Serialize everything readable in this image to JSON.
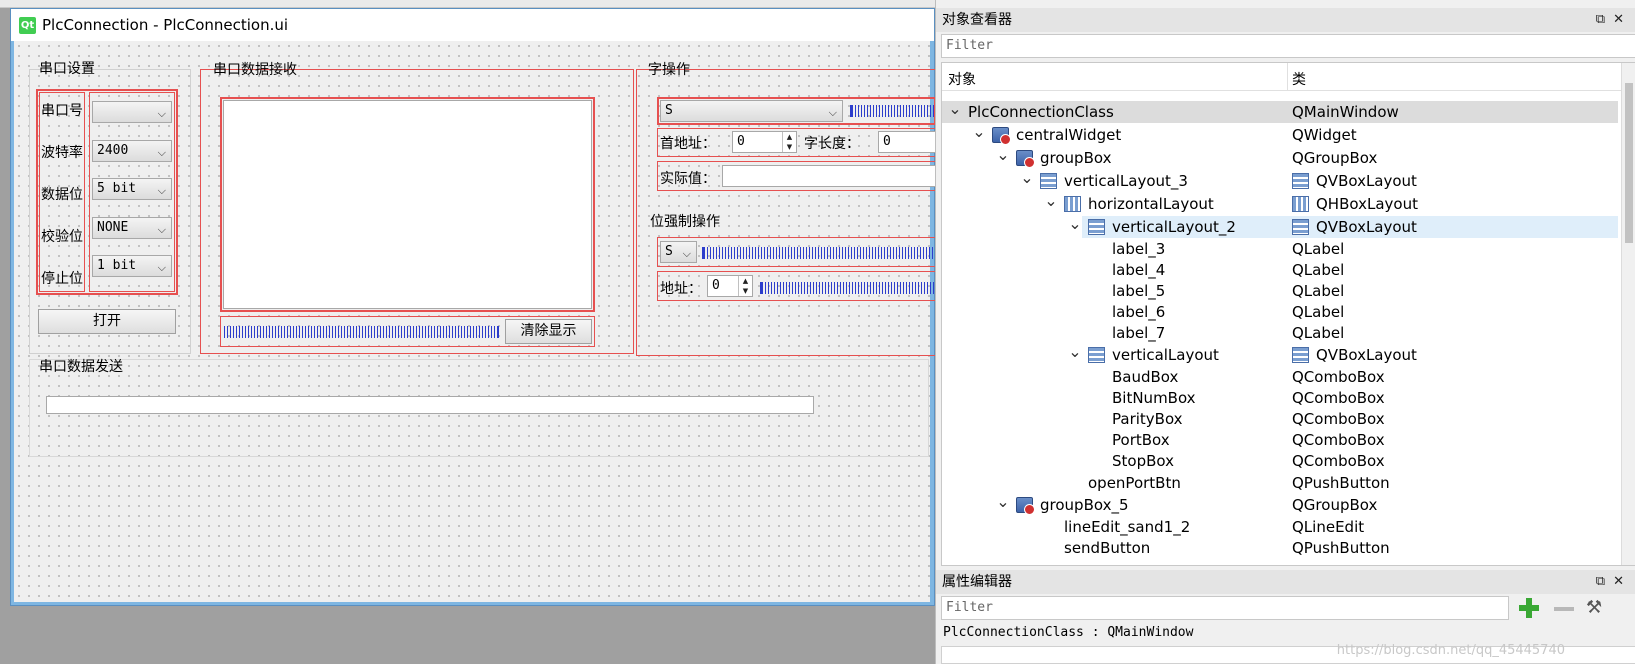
{
  "form": {
    "title": "PlcConnection - PlcConnection.ui",
    "logo_text": "Qt",
    "serial_group": {
      "title": "串口设置",
      "labels": [
        "串口号",
        "波特率",
        "数据位",
        "校验位",
        "停止位"
      ],
      "port_value": "",
      "baud_value": "2400",
      "databits_value": "5 bit",
      "parity_value": "NONE",
      "stopbits_value": "1 bit",
      "open_button": "打开"
    },
    "receive_group": {
      "title": "串口数据接收",
      "clear_button": "清除显示"
    },
    "send_group": {
      "title": "串口数据发送"
    },
    "word_group": {
      "title": "字操作",
      "area_value": "S",
      "start_addr_label": "首地址：",
      "start_addr_value": "0",
      "word_len_label": "字长度：",
      "word_len_value": "0",
      "actual_label": "实际值："
    },
    "bit_group": {
      "title": "位强制操作",
      "area_value": "S",
      "addr_label": "地址：",
      "addr_value": "0"
    }
  },
  "object_inspector": {
    "title": "对象查看器",
    "filter_placeholder": "Filter",
    "col_object": "对象",
    "col_class": "类",
    "rows": [
      {
        "name": "PlcConnectionClass",
        "cls": "QMainWindow"
      },
      {
        "name": "centralWidget",
        "cls": "QWidget"
      },
      {
        "name": "groupBox",
        "cls": "QGroupBox"
      },
      {
        "name": "verticalLayout_3",
        "cls": "QVBoxLayout"
      },
      {
        "name": "horizontalLayout",
        "cls": "QHBoxLayout"
      },
      {
        "name": "verticalLayout_2",
        "cls": "QVBoxLayout"
      },
      {
        "name": "label_3",
        "cls": "QLabel"
      },
      {
        "name": "label_4",
        "cls": "QLabel"
      },
      {
        "name": "label_5",
        "cls": "QLabel"
      },
      {
        "name": "label_6",
        "cls": "QLabel"
      },
      {
        "name": "label_7",
        "cls": "QLabel"
      },
      {
        "name": "verticalLayout",
        "cls": "QVBoxLayout"
      },
      {
        "name": "BaudBox",
        "cls": "QComboBox"
      },
      {
        "name": "BitNumBox",
        "cls": "QComboBox"
      },
      {
        "name": "ParityBox",
        "cls": "QComboBox"
      },
      {
        "name": "PortBox",
        "cls": "QComboBox"
      },
      {
        "name": "StopBox",
        "cls": "QComboBox"
      },
      {
        "name": "openPortBtn",
        "cls": "QPushButton"
      },
      {
        "name": "groupBox_5",
        "cls": "QGroupBox"
      },
      {
        "name": "lineEdit_sand1_2",
        "cls": "QLineEdit"
      },
      {
        "name": "sendButton",
        "cls": "QPushButton"
      }
    ]
  },
  "property_editor": {
    "title": "属性编辑器",
    "filter_placeholder": "Filter",
    "selected_object": "PlcConnectionClass : QMainWindow"
  },
  "watermark": "https://blog.csdn.net/qq_45445740"
}
